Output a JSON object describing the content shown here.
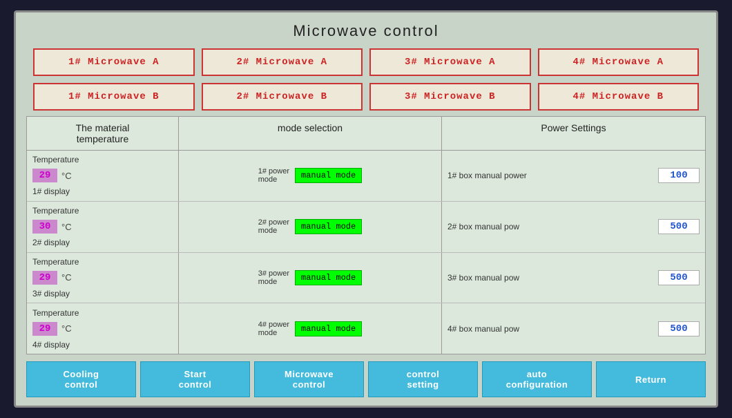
{
  "title": "Microwave control",
  "row_a": [
    {
      "label": "1# Microwave A"
    },
    {
      "label": "2# Microwave A"
    },
    {
      "label": "3# Microwave A"
    },
    {
      "label": "4# Microwave A"
    }
  ],
  "row_b": [
    {
      "label": "1# Microwave B"
    },
    {
      "label": "2# Microwave B"
    },
    {
      "label": "3# Microwave B"
    },
    {
      "label": "4# Microwave B"
    }
  ],
  "table": {
    "col1_header": "The material\ntemperature",
    "col2_header": "mode selection",
    "col3_header": "Power Settings",
    "rows": [
      {
        "temp_label1": "Temperature",
        "temp_label2": "1# display",
        "temp_value": "29",
        "unit": "°C",
        "power_label": "1# power\nmode",
        "mode_btn": "manual mode",
        "power_desc": "1# box manual power",
        "power_value": "100"
      },
      {
        "temp_label1": "Temperature",
        "temp_label2": "2# display",
        "temp_value": "30",
        "unit": "°C",
        "power_label": "2# power\nmode",
        "mode_btn": "manual mode",
        "power_desc": "2# box manual pow",
        "power_value": "500"
      },
      {
        "temp_label1": "Temperature",
        "temp_label2": "3# display",
        "temp_value": "29",
        "unit": "°C",
        "power_label": "3# power\nmode",
        "mode_btn": "manual mode",
        "power_desc": "3# box manual pow",
        "power_value": "500"
      },
      {
        "temp_label1": "Temperature",
        "temp_label2": "4# display",
        "temp_value": "29",
        "unit": "°C",
        "power_label": "4# power\nmode",
        "mode_btn": "manual mode",
        "power_desc": "4# box manual pow",
        "power_value": "500"
      }
    ]
  },
  "bottom_buttons": [
    {
      "label": "Cooling\ncontrol",
      "name": "cooling-control-button"
    },
    {
      "label": "Start\ncontrol",
      "name": "start-control-button"
    },
    {
      "label": "Microwave\ncontrol",
      "name": "microwave-control-button"
    },
    {
      "label": "control\nsetting",
      "name": "control-setting-button"
    },
    {
      "label": "auto\nconfiguration",
      "name": "auto-configuration-button"
    },
    {
      "label": "Return",
      "name": "return-button"
    }
  ]
}
